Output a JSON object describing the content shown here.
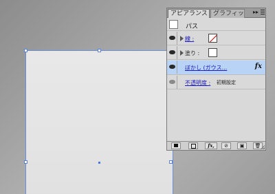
{
  "panel": {
    "tabs": [
      {
        "label": "アピアランス",
        "active": true
      },
      {
        "label": "グラフィック",
        "active": false
      }
    ],
    "tab_arrows": "▸▸",
    "title_row": {
      "label": "パス"
    },
    "stroke": {
      "label": "線 :",
      "swatch": "none"
    },
    "fill": {
      "label": "塗り :",
      "swatch": "white"
    },
    "effect": {
      "label": "ぼかし (ガウス...",
      "fx_mark": "fx"
    },
    "opacity": {
      "label": "不透明度 :",
      "value": "初期設定"
    },
    "bottom_buttons": {
      "fx_label": "fx,"
    }
  },
  "colors": {
    "selection": "#5a80d8",
    "panel_bg": "#d9d9d9",
    "effect_row_highlight": "#b8d3f5",
    "link_text": "#1a1ac0"
  }
}
